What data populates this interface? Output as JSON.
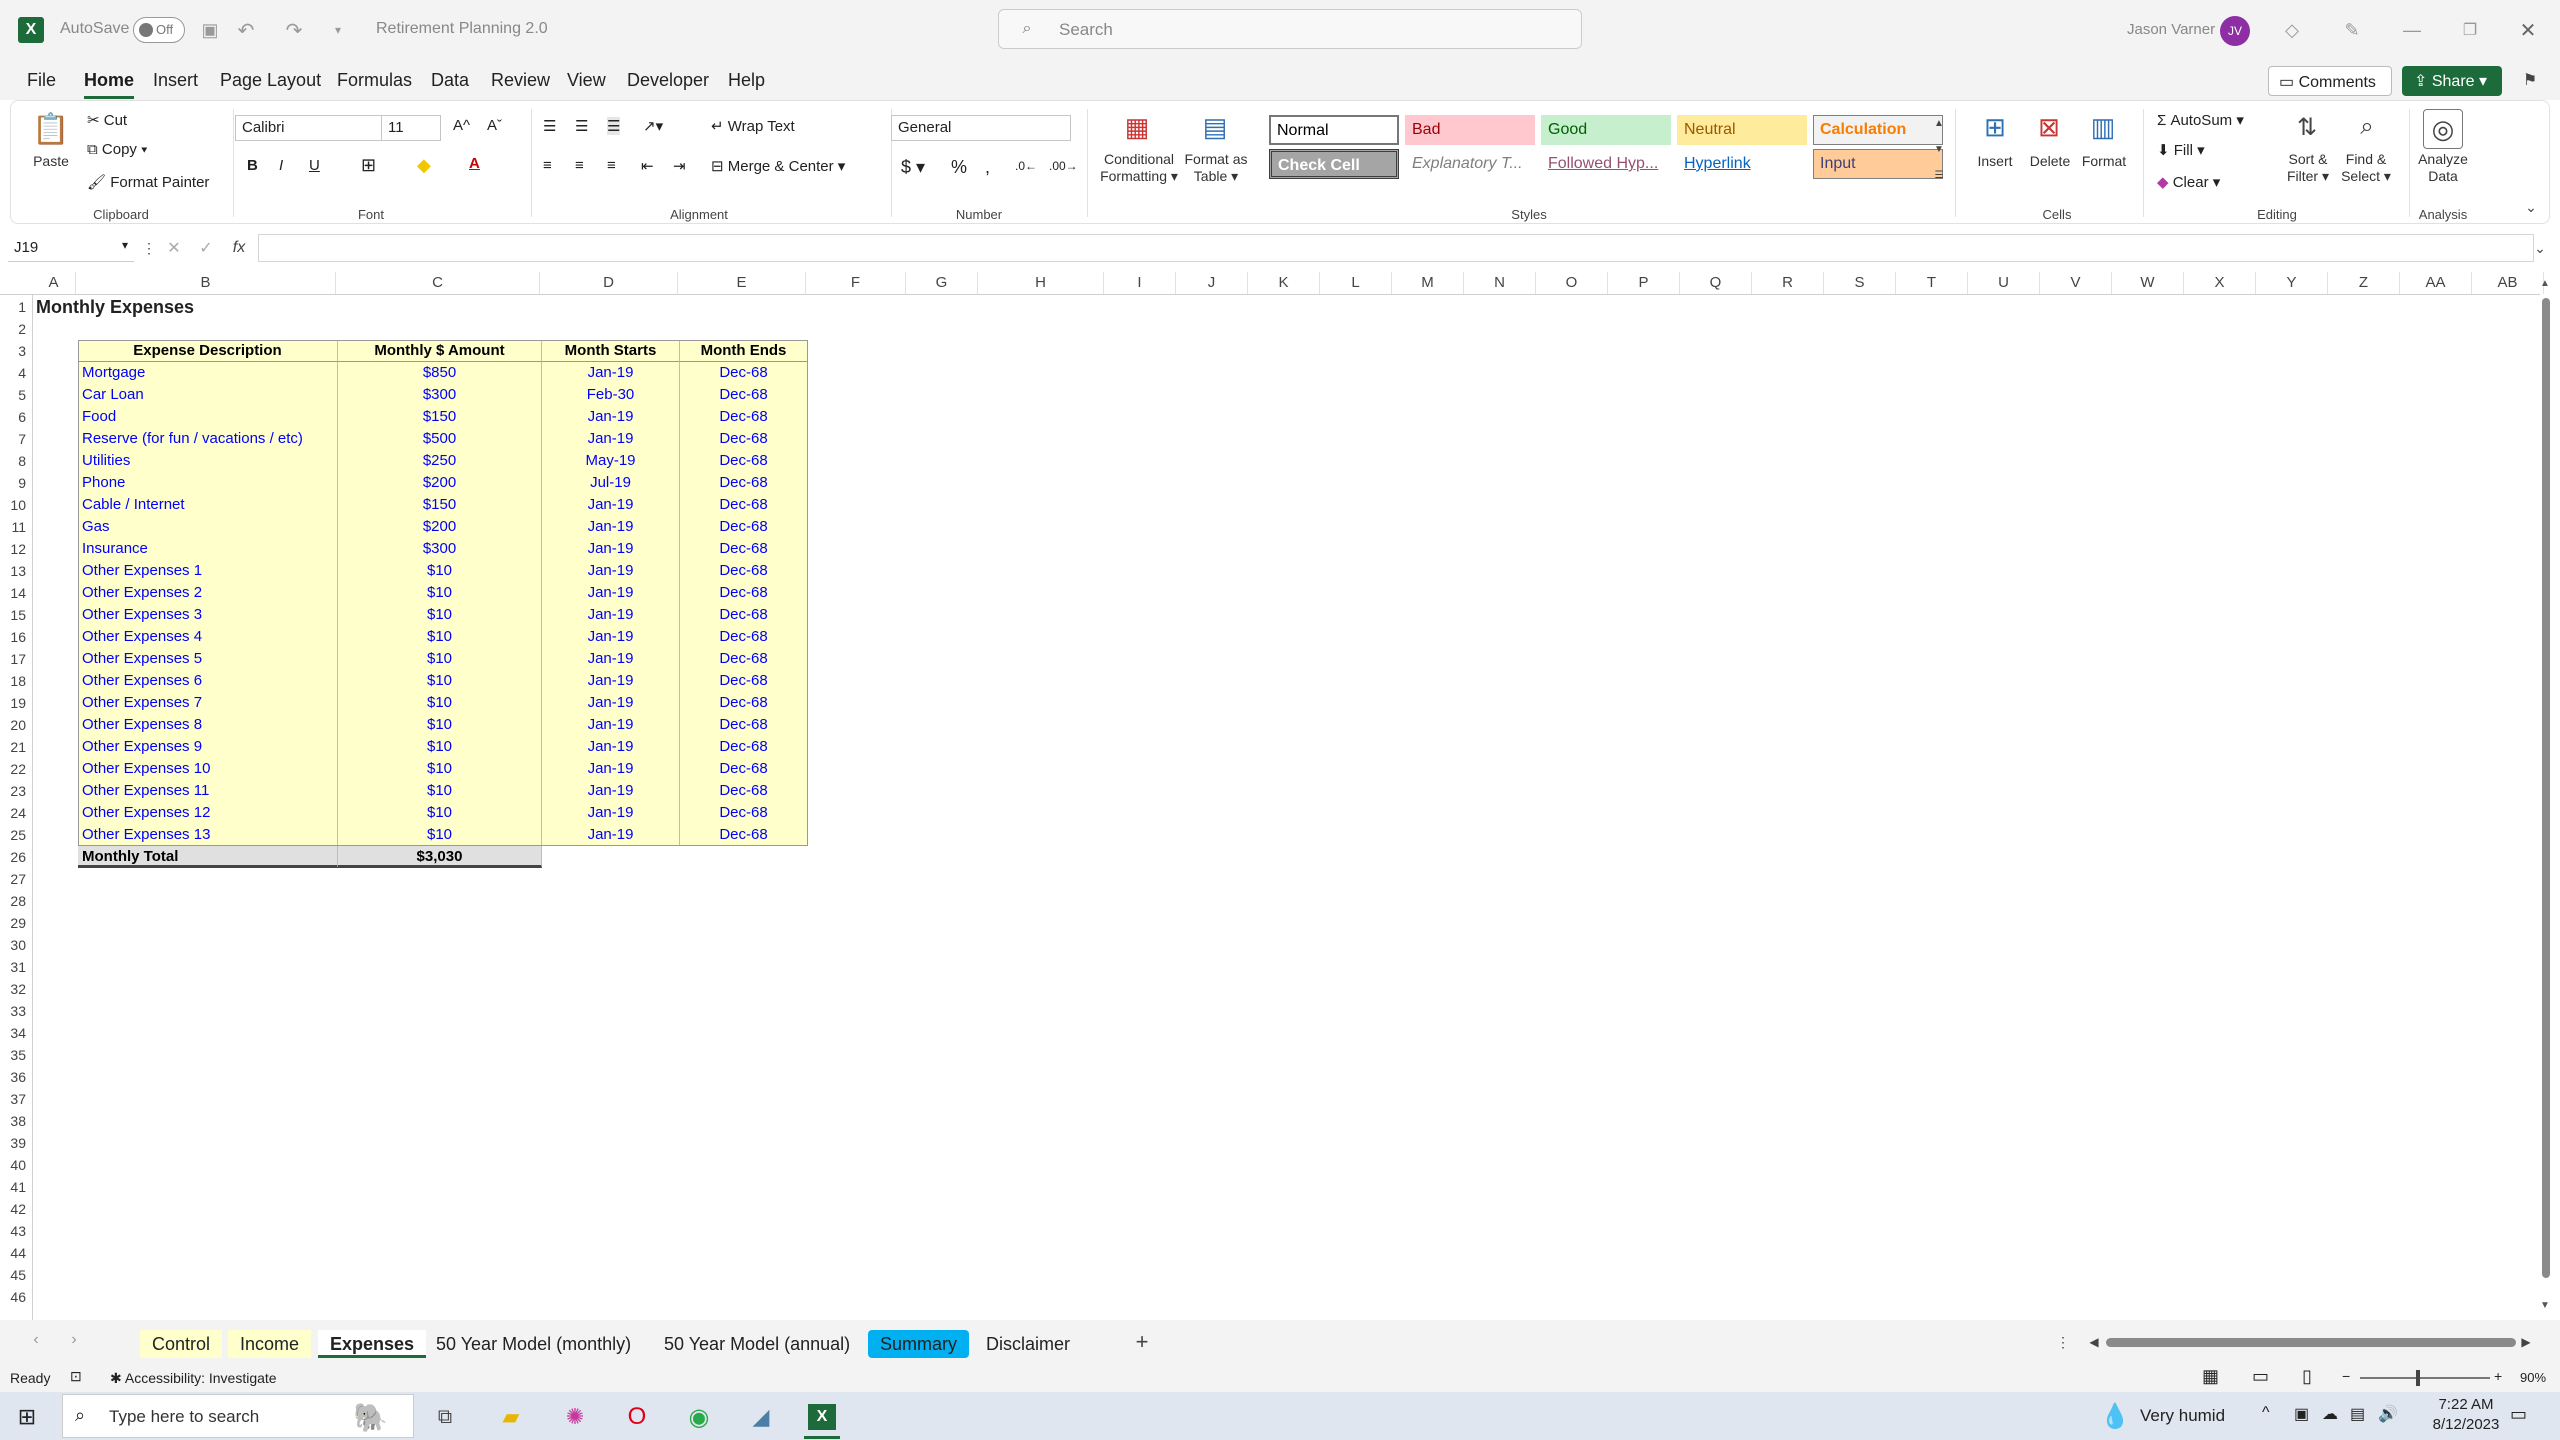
{
  "title_bar": {
    "autosave_label": "AutoSave",
    "autosave_state": "Off",
    "doc_title": "Retirement Planning 2.0",
    "search_placeholder": "Search",
    "user_name": "Jason Varner",
    "user_initials": "JV"
  },
  "menu": [
    "File",
    "Home",
    "Insert",
    "Page Layout",
    "Formulas",
    "Data",
    "Review",
    "View",
    "Developer",
    "Help"
  ],
  "menu_right": {
    "comments": "Comments",
    "share": "Share"
  },
  "ribbon": {
    "clipboard": {
      "paste": "Paste",
      "cut": "Cut",
      "copy": "Copy",
      "format_painter": "Format Painter",
      "group": "Clipboard"
    },
    "font": {
      "name": "Calibri",
      "size": "11",
      "group": "Font"
    },
    "alignment": {
      "wrap": "Wrap Text",
      "merge": "Merge & Center",
      "group": "Alignment"
    },
    "number": {
      "format": "General",
      "group": "Number"
    },
    "styles": {
      "conditional": [
        "Conditional",
        "Formatting"
      ],
      "format_table": [
        "Format as",
        "Table"
      ],
      "group": "Styles",
      "cells": [
        {
          "label": "Normal",
          "bg": "#ffffff",
          "fg": "#000000"
        },
        {
          "label": "Bad",
          "bg": "#ffc7ce",
          "fg": "#9c0006"
        },
        {
          "label": "Good",
          "bg": "#c6efce",
          "fg": "#006100"
        },
        {
          "label": "Neutral",
          "bg": "#ffeb9c",
          "fg": "#9c5700"
        },
        {
          "label": "Calculation",
          "bg": "#f2f2f2",
          "fg": "#fa7d00"
        },
        {
          "label": "Check Cell",
          "bg": "#a5a5a5",
          "fg": "#ffffff"
        },
        {
          "label": "Explanatory T...",
          "bg": "#ffffff",
          "fg": "#7f7f7f"
        },
        {
          "label": "Followed Hyp...",
          "bg": "#ffffff",
          "fg": "#954f72"
        },
        {
          "label": "Hyperlink",
          "bg": "#ffffff",
          "fg": "#0563c1"
        },
        {
          "label": "Input",
          "bg": "#ffcc99",
          "fg": "#3f3f76"
        }
      ]
    },
    "cells": {
      "insert": "Insert",
      "delete": "Delete",
      "format": "Format",
      "group": "Cells"
    },
    "editing": {
      "autosum": "AutoSum",
      "fill": "Fill",
      "clear": "Clear",
      "sort": [
        "Sort &",
        "Filter"
      ],
      "find": [
        "Find &",
        "Select"
      ],
      "group": "Editing"
    },
    "analysis": {
      "analyze": [
        "Analyze",
        "Data"
      ],
      "group": "Analysis"
    }
  },
  "formula_bar": {
    "name_box": "J19",
    "formula": ""
  },
  "columns": [
    "A",
    "B",
    "C",
    "D",
    "E",
    "F",
    "G",
    "H",
    "I",
    "J",
    "K",
    "L",
    "M",
    "N",
    "O",
    "P",
    "Q",
    "R",
    "S",
    "T",
    "U",
    "V",
    "W",
    "X",
    "Y",
    "Z",
    "AA",
    "AB"
  ],
  "sheet": {
    "title": "Monthly Expenses",
    "headers": [
      "Expense Description",
      "Monthly $ Amount",
      "Month Starts",
      "Month Ends"
    ],
    "rows": [
      [
        "Mortgage",
        "$850",
        "Jan-19",
        "Dec-68"
      ],
      [
        "Car Loan",
        "$300",
        "Feb-30",
        "Dec-68"
      ],
      [
        "Food",
        "$150",
        "Jan-19",
        "Dec-68"
      ],
      [
        "Reserve (for fun / vacations / etc)",
        "$500",
        "Jan-19",
        "Dec-68"
      ],
      [
        "Utilities",
        "$250",
        "May-19",
        "Dec-68"
      ],
      [
        "Phone",
        "$200",
        "Jul-19",
        "Dec-68"
      ],
      [
        "Cable / Internet",
        "$150",
        "Jan-19",
        "Dec-68"
      ],
      [
        "Gas",
        "$200",
        "Jan-19",
        "Dec-68"
      ],
      [
        "Insurance",
        "$300",
        "Jan-19",
        "Dec-68"
      ],
      [
        "Other Expenses 1",
        "$10",
        "Jan-19",
        "Dec-68"
      ],
      [
        "Other Expenses 2",
        "$10",
        "Jan-19",
        "Dec-68"
      ],
      [
        "Other Expenses 3",
        "$10",
        "Jan-19",
        "Dec-68"
      ],
      [
        "Other Expenses 4",
        "$10",
        "Jan-19",
        "Dec-68"
      ],
      [
        "Other Expenses 5",
        "$10",
        "Jan-19",
        "Dec-68"
      ],
      [
        "Other Expenses 6",
        "$10",
        "Jan-19",
        "Dec-68"
      ],
      [
        "Other Expenses 7",
        "$10",
        "Jan-19",
        "Dec-68"
      ],
      [
        "Other Expenses 8",
        "$10",
        "Jan-19",
        "Dec-68"
      ],
      [
        "Other Expenses 9",
        "$10",
        "Jan-19",
        "Dec-68"
      ],
      [
        "Other Expenses 10",
        "$10",
        "Jan-19",
        "Dec-68"
      ],
      [
        "Other Expenses 11",
        "$10",
        "Jan-19",
        "Dec-68"
      ],
      [
        "Other Expenses 12",
        "$10",
        "Jan-19",
        "Dec-68"
      ],
      [
        "Other Expenses 13",
        "$10",
        "Jan-19",
        "Dec-68"
      ]
    ],
    "total_label": "Monthly Total",
    "total_value": "$3,030",
    "row_numbers": [
      "1",
      "2",
      "3",
      "4",
      "5",
      "6",
      "7",
      "8",
      "9",
      "10",
      "11",
      "12",
      "13",
      "14",
      "15",
      "16",
      "17",
      "18",
      "19",
      "20",
      "21",
      "22",
      "23",
      "24",
      "25",
      "26",
      "27",
      "28",
      "29",
      "30",
      "31",
      "32",
      "33",
      "34",
      "35",
      "36",
      "37",
      "38",
      "39",
      "40",
      "41",
      "42",
      "43",
      "44",
      "45",
      "46"
    ]
  },
  "tabs": [
    {
      "label": "Control",
      "bg": "#ffffcc"
    },
    {
      "label": "Income",
      "bg": "#ffffcc"
    },
    {
      "label": "Expenses",
      "bg": "#ffffff",
      "active": true
    },
    {
      "label": "50 Year Model (monthly)",
      "bg": ""
    },
    {
      "label": "50 Year Model (annual)",
      "bg": ""
    },
    {
      "label": "Summary",
      "bg": "#00b0f0"
    },
    {
      "label": "Disclaimer",
      "bg": ""
    }
  ],
  "status": {
    "ready": "Ready",
    "accessibility": "Accessibility: Investigate",
    "zoom": "90%"
  },
  "taskbar": {
    "search_placeholder": "Type here to search",
    "weather": "Very humid",
    "time": "7:22 AM",
    "date": "8/12/2023"
  },
  "colors": {
    "excel_green": "#1d6b3a",
    "table_fill": "#ffffcc",
    "blue_text": "#0000ff"
  }
}
